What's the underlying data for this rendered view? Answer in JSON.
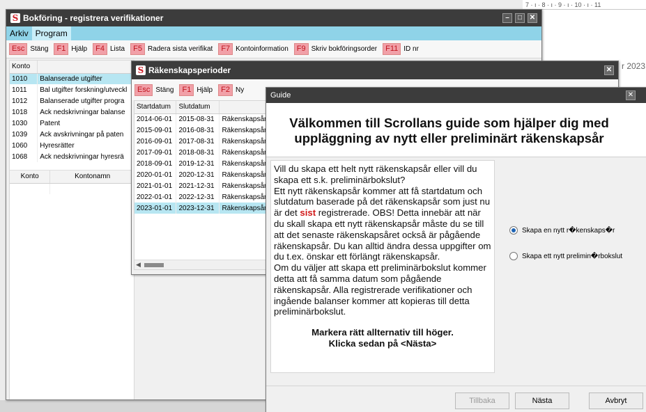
{
  "background": {
    "ruler_text": "7 · ı · 8 · ı · 9 · ı · 10 · ı · 11",
    "year_fragment": "r 2023"
  },
  "main_window": {
    "title": "Bokföring - registrera verifikationer",
    "menu": [
      "Arkiv",
      "Program"
    ],
    "toolbar": [
      {
        "key": "Esc",
        "label": "Stäng"
      },
      {
        "key": "F1",
        "label": "Hjälp"
      },
      {
        "key": "F4",
        "label": "Lista"
      },
      {
        "key": "F5",
        "label": "Radera sista verifikat"
      },
      {
        "key": "F7",
        "label": "Kontoinformation"
      },
      {
        "key": "F9",
        "label": "Skriv bokföringsorder"
      },
      {
        "key": "F11",
        "label": "ID nr"
      }
    ],
    "accounts_header": "Konto",
    "accounts": [
      {
        "konto": "1010",
        "name": "Balanserade utgifter"
      },
      {
        "konto": "1011",
        "name": "Bal utgifter forskning/utveckl"
      },
      {
        "konto": "1012",
        "name": "Balanserade utgifter progra"
      },
      {
        "konto": "1018",
        "name": "Ack nedskrivningar balanse"
      },
      {
        "konto": "1030",
        "name": "Patent"
      },
      {
        "konto": "1039",
        "name": "Ack avskrivningar på paten"
      },
      {
        "konto": "1060",
        "name": "Hyresrätter"
      },
      {
        "konto": "1068",
        "name": "Ack nedskrivningar hyresrä"
      }
    ],
    "lower_headers": [
      "Konto",
      "Kontonamn"
    ]
  },
  "period_window": {
    "title": "Räkenskapsperioder",
    "toolbar": [
      {
        "key": "Esc",
        "label": "Stäng"
      },
      {
        "key": "F1",
        "label": "Hjälp"
      },
      {
        "key": "F2",
        "label": "Ny"
      }
    ],
    "headers": [
      "Startdatum",
      "Slutdatum",
      ""
    ],
    "rows": [
      {
        "start": "2014-06-01",
        "end": "2015-08-31",
        "type": "Räkenskapsår"
      },
      {
        "start": "2015-09-01",
        "end": "2016-08-31",
        "type": "Räkenskapsår"
      },
      {
        "start": "2016-09-01",
        "end": "2017-08-31",
        "type": "Räkenskapsår"
      },
      {
        "start": "2017-09-01",
        "end": "2018-08-31",
        "type": "Räkenskapsår"
      },
      {
        "start": "2018-09-01",
        "end": "2019-12-31",
        "type": "Räkenskapsår"
      },
      {
        "start": "2020-01-01",
        "end": "2020-12-31",
        "type": "Räkenskapsår"
      },
      {
        "start": "2021-01-01",
        "end": "2021-12-31",
        "type": "Räkenskapsår"
      },
      {
        "start": "2022-01-01",
        "end": "2022-12-31",
        "type": "Räkenskapsår"
      },
      {
        "start": "2023-01-01",
        "end": "2023-12-31",
        "type": "Räkenskapsår"
      }
    ]
  },
  "guide_window": {
    "title": "Guide",
    "heading_line1": "Välkommen till Scrollans guide som hjälper dig med",
    "heading_line2": "uppläggning av nytt eller preliminärt räkenskapsår",
    "text_part1": "Vill du skapa ett helt nytt räkenskapsår eller vill du skapa ett s.k. preliminärbokslut?",
    "text_part2": "Ett nytt räkenskapsår kommer att få startdatum och slutdatum baserade på det räkenskapsår som just nu är det ",
    "text_highlight": "sist",
    "text_part3": " registrerade. OBS! Detta innebär att när du skall skapa ett nytt räkenskapsår måste du se till att det senaste räkenskapsåret också är pågående räkenskapsår. Du kan alltid ändra dessa uppgifter om du t.ex. önskar ett förlängt räkenskapsår.",
    "text_part4": "Om du väljer att skapa ett preliminärbokslut kommer detta att få samma datum som pågående räkenskapsår. Alla registrerade verifikationer och ingående balanser kommer att kopieras till detta preliminärbokslut.",
    "instruction1": "Markera rätt allternativ till höger.",
    "instruction2": "Klicka sedan på <Nästa>",
    "options": [
      {
        "label": "Skapa en nytt r�kenskaps�r",
        "selected": true
      },
      {
        "label": "Skapa ett nytt prelimin�rbokslut",
        "selected": false
      }
    ],
    "buttons": {
      "back": "Tillbaka",
      "next": "Nästa",
      "cancel": "Avbryt"
    }
  }
}
